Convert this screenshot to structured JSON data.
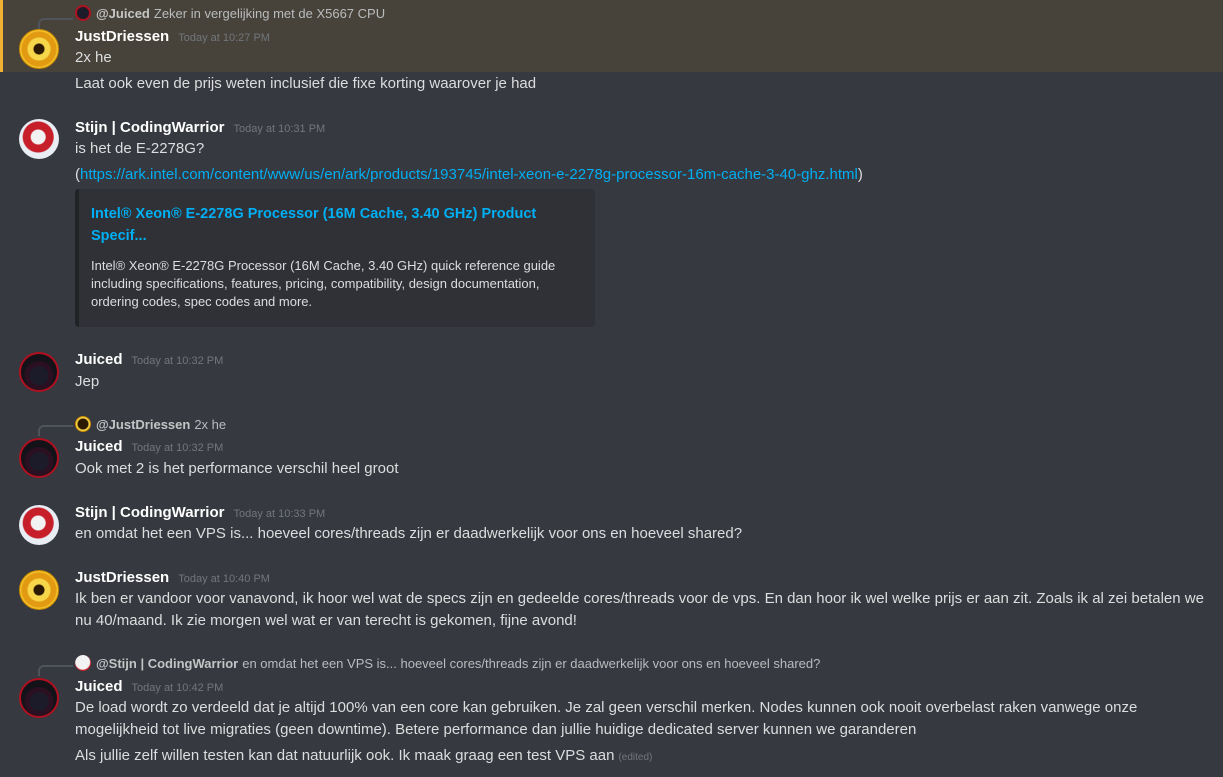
{
  "messages": [
    {
      "reply": {
        "author": "@Juiced",
        "text": "Zeker in vergelijking met de X5667 CPU"
      },
      "author": "JustDriessen",
      "time": "Today at 10:27 PM",
      "lines": [
        "2x he",
        "Laat ook even de prijs weten inclusief die fixe korting waarover je had"
      ]
    },
    {
      "author": "Stijn | CodingWarrior",
      "time": "Today at 10:31 PM",
      "lines": [
        "is het de E-2278G?"
      ],
      "link_prefix": "(",
      "link": "https://ark.intel.com/content/www/us/en/ark/products/193745/intel-xeon-e-2278g-processor-16m-cache-3-40-ghz.html",
      "link_suffix": ")",
      "embed": {
        "title": "Intel® Xeon® E-2278G Processor (16M Cache, 3.40 GHz) Product Specif...",
        "description": "Intel® Xeon® E-2278G Processor (16M Cache, 3.40 GHz) quick reference guide including specifications, features, pricing, compatibility, design documentation, ordering codes, spec codes and more."
      }
    },
    {
      "author": "Juiced",
      "time": "Today at 10:32 PM",
      "lines": [
        "Jep"
      ]
    },
    {
      "reply": {
        "author": "@JustDriessen",
        "text": "2x he"
      },
      "author": "Juiced",
      "time": "Today at 10:32 PM",
      "lines": [
        "Ook met 2 is het performance verschil heel groot"
      ]
    },
    {
      "author": "Stijn | CodingWarrior",
      "time": "Today at 10:33 PM",
      "lines": [
        "en omdat het een VPS is... hoeveel cores/threads zijn er daadwerkelijk voor ons en hoeveel shared?"
      ]
    },
    {
      "author": "JustDriessen",
      "time": "Today at 10:40 PM",
      "lines": [
        "Ik ben er vandoor voor vanavond, ik hoor wel wat de specs zijn en gedeelde cores/threads voor de vps. En dan hoor ik wel welke prijs er aan zit. Zoals ik al zei betalen we nu 40/maand. Ik zie morgen wel wat er van terecht is gekomen, fijne avond!"
      ]
    },
    {
      "reply": {
        "author": "@Stijn | CodingWarrior",
        "text": "en omdat het een VPS is... hoeveel cores/threads zijn er daadwerkelijk voor ons en hoeveel shared?"
      },
      "author": "Juiced",
      "time": "Today at 10:42 PM",
      "lines": [
        "De load wordt zo verdeeld dat je altijd 100% van een core kan gebruiken. Je zal geen verschil merken. Nodes kunnen ook nooit overbelast raken vanwege onze mogelijkheid tot live migraties (geen downtime). Betere performance dan jullie huidige dedicated server kunnen we garanderen",
        "Als jullie zelf willen testen kan dat natuurlijk ook. Ik maak graag een test VPS aan"
      ],
      "edited_label": "(edited)"
    }
  ]
}
